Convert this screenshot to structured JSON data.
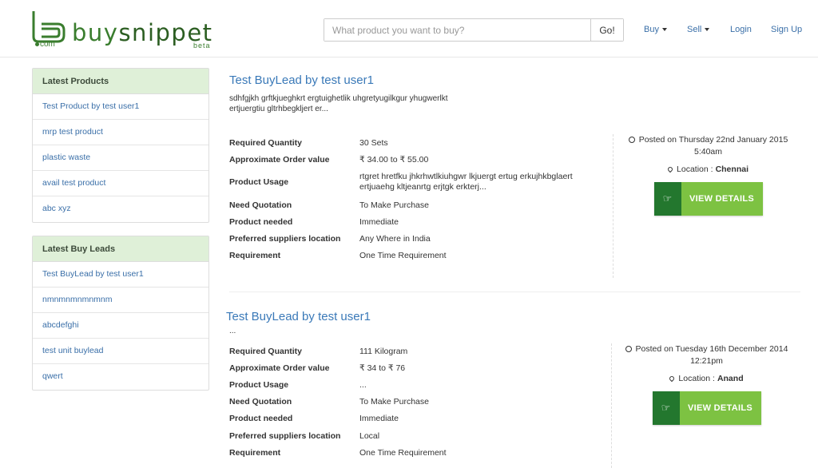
{
  "header": {
    "brand_buy": "buy",
    "brand_snippet": "snippet",
    "brand_com": "com",
    "brand_beta": "beta",
    "search_placeholder": "What product you want to buy?",
    "search_button": "Go!",
    "nav": {
      "buy": "Buy",
      "sell": "Sell",
      "login": "Login",
      "signup": "Sign Up"
    }
  },
  "sidebar": {
    "latest_products": {
      "title": "Latest Products",
      "items": [
        "Test Product by test user1",
        "mrp test product",
        "plastic waste",
        "avail test product",
        "abc xyz"
      ]
    },
    "latest_buy_leads": {
      "title": "Latest Buy Leads",
      "items": [
        "Test BuyLead by test user1",
        "nmnmnmnmnmnm",
        "abcdefghi",
        "test unit buylead",
        "qwert"
      ]
    }
  },
  "labels": {
    "required_quantity": "Required Quantity",
    "approx_value": "Approximate Order value",
    "product_usage": "Product Usage",
    "need_quotation": "Need Quotation",
    "product_needed": "Product needed",
    "preferred_location": "Preferred suppliers location",
    "requirement": "Requirement",
    "location_prefix": "Location :",
    "view_details": "VIEW DETAILS"
  },
  "leads": [
    {
      "title": "Test BuyLead by test user1",
      "description": "sdhfgjkh grftkjueghkrt ergtuighetlik uhgretyugilkgur yhugwerlkt ertjuergtiu gltrhbegkljert er...",
      "required_quantity": "30   Sets",
      "approx_value": "₹ 34.00   to   ₹ 55.00",
      "product_usage": "rtgret hretfku jhkrhwtlkiuhgwr lkjuergt ertug erkujhkbglaert ertjuaehg kltjeanrtg erjtgk erkterj...",
      "need_quotation": "To Make Purchase",
      "product_needed": "Immediate",
      "preferred_location": "Any Where in India",
      "requirement": "One Time Requirement",
      "posted": "Posted on Thursday 22nd January 2015 5:40am",
      "location": "Chennai"
    },
    {
      "title": "Test BuyLead by test user1",
      "description": "...",
      "required_quantity": "111   Kilogram",
      "approx_value": "₹ 34   to   ₹ 76",
      "product_usage": "...",
      "need_quotation": "To Make Purchase",
      "product_needed": "Immediate",
      "preferred_location": "Local",
      "requirement": "One Time Requirement",
      "posted": "Posted on Tuesday 16th December 2014 12:21pm",
      "location": "Anand"
    }
  ]
}
